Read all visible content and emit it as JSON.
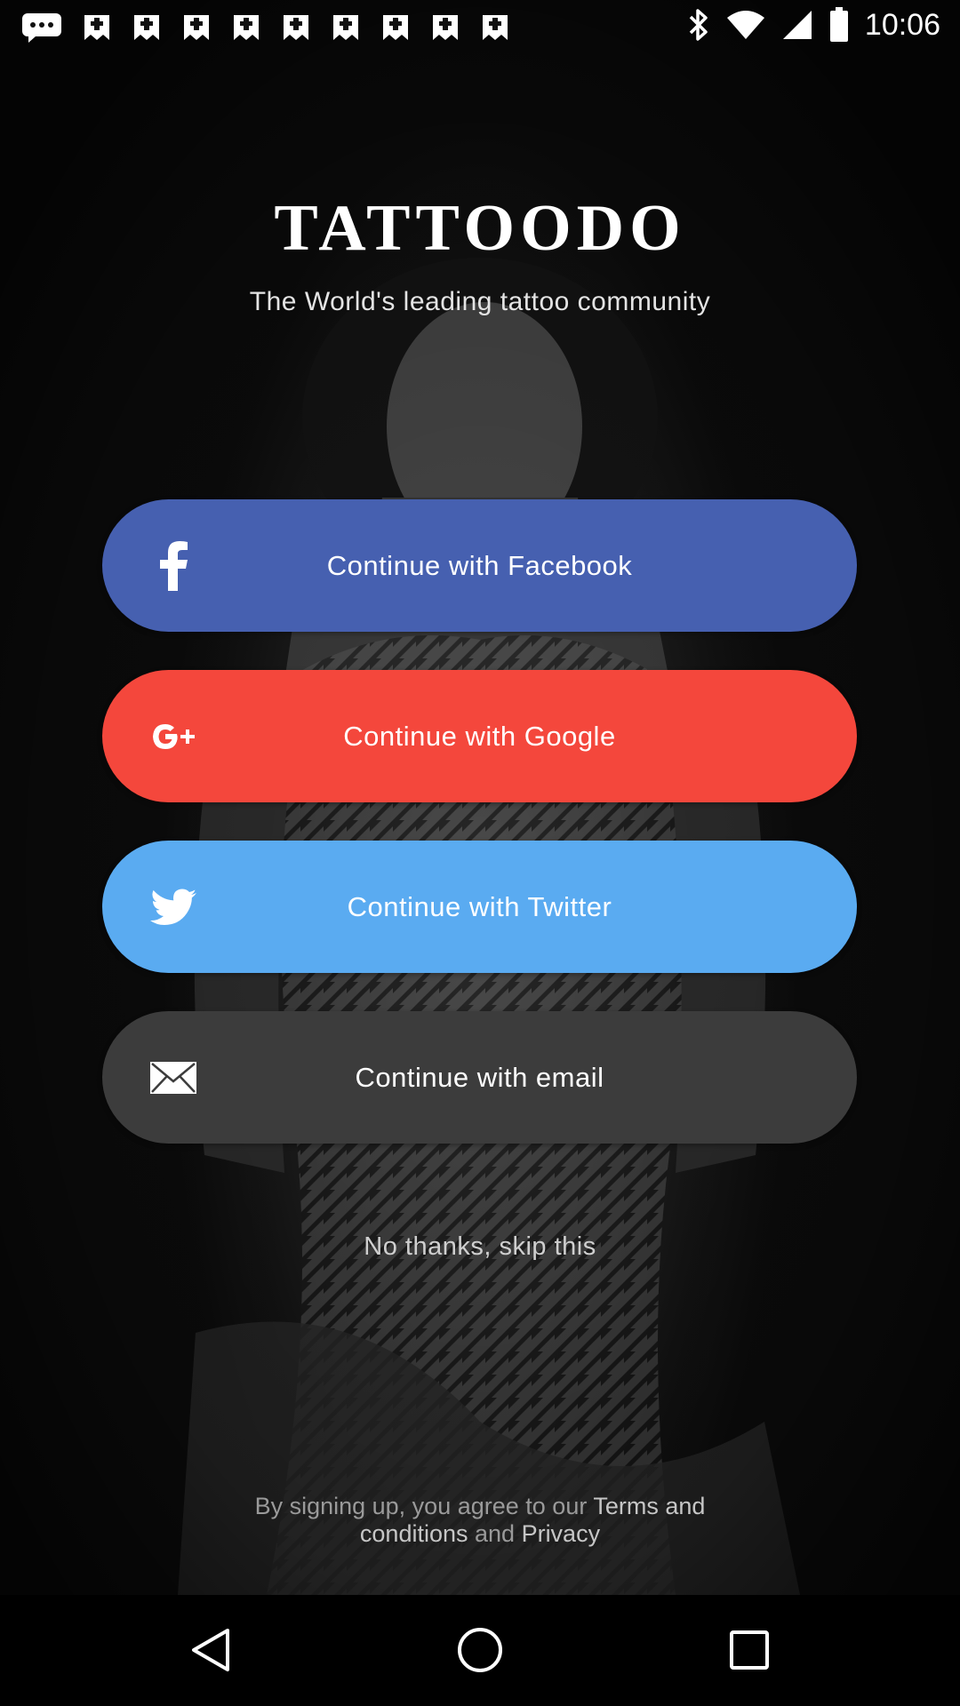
{
  "status_bar": {
    "time": "10:06",
    "notification_icons": [
      "chat-bubble-icon",
      "ticket-icon",
      "ticket-icon",
      "ticket-icon",
      "ticket-icon",
      "ticket-icon",
      "ticket-icon",
      "ticket-icon",
      "ticket-icon",
      "ticket-icon"
    ],
    "system_icons": [
      "bluetooth-icon",
      "wifi-icon",
      "signal-icon",
      "battery-icon"
    ]
  },
  "header": {
    "logo": "TATTOODO",
    "tagline": "The World's leading tattoo community"
  },
  "login": {
    "facebook_label": "Continue with Facebook",
    "google_label": "Continue with Google",
    "twitter_label": "Continue with Twitter",
    "email_label": "Continue with email",
    "skip_label": "No thanks, skip this"
  },
  "legal": {
    "prefix": "By signing up, you agree to our ",
    "terms": "Terms and conditions",
    "middle": " and ",
    "privacy": "Privacy"
  },
  "colors": {
    "facebook": "#4660b0",
    "google": "#f4473c",
    "twitter": "#5aabf1",
    "email": "#3c3c3c"
  },
  "nav_bar": {
    "icons": [
      "back-icon",
      "home-icon",
      "recents-icon"
    ]
  }
}
